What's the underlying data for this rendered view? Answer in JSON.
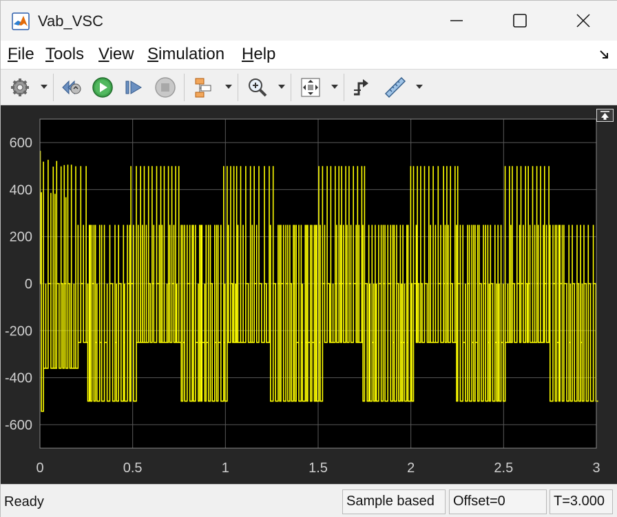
{
  "window": {
    "title": "Vab_VSC",
    "icons": {
      "app": "matlab-logo-icon",
      "minimize": "minimize-icon",
      "maximize": "maximize-icon",
      "close": "close-icon"
    }
  },
  "menu": {
    "items": [
      "File",
      "Tools",
      "View",
      "Simulation",
      "Help"
    ]
  },
  "toolbar": {
    "buttons": [
      {
        "name": "configuration-gear-icon",
        "dropdown": true
      },
      {
        "name": "step-back-icon",
        "dropdown": false
      },
      {
        "name": "run-icon",
        "dropdown": false
      },
      {
        "name": "step-forward-icon",
        "dropdown": false
      },
      {
        "name": "stop-icon",
        "dropdown": false
      },
      {
        "name": "highlight-block-icon",
        "dropdown": true
      },
      {
        "name": "zoom-icon",
        "dropdown": true
      },
      {
        "name": "fit-to-view-icon",
        "dropdown": true
      },
      {
        "name": "triggers-icon",
        "dropdown": false
      },
      {
        "name": "measurements-ruler-icon",
        "dropdown": true
      }
    ]
  },
  "colors": {
    "plot_background": "#000000",
    "panel_background": "#262626",
    "signal": "#ffff00",
    "grid": "#5a5a5a",
    "tick_text": "#d0d0d0"
  },
  "chart_data": {
    "type": "line",
    "title": "",
    "xlabel": "",
    "ylabel": "",
    "xlim": [
      0,
      3
    ],
    "ylim": [
      -700,
      700
    ],
    "xticks": [
      0,
      0.5,
      1,
      1.5,
      2,
      2.5,
      3
    ],
    "xtick_labels": [
      "0",
      "0.5",
      "1",
      "1.5",
      "2",
      "2.5",
      "3"
    ],
    "yticks": [
      -600,
      -400,
      -200,
      0,
      200,
      400,
      600
    ],
    "ytick_labels": [
      "-600",
      "-400",
      "-200",
      "0",
      "200",
      "400",
      "600"
    ],
    "grid": true,
    "series": [
      {
        "description_levels": [
          -500,
          -250,
          0,
          250,
          500
        ],
        "startup_transient": {
          "peak_positive": 565,
          "peak_negative": -530,
          "settle_time": 0.2
        },
        "steady_state_levels": {
          "outer_pos": 500,
          "inner_pos": 250,
          "zero": 0,
          "inner_neg": -250,
          "outer_neg": -500
        }
      }
    ]
  },
  "status": {
    "ready": "Ready",
    "sample_mode": "Sample based",
    "offset": "Offset=0",
    "time": "T=3.000"
  }
}
